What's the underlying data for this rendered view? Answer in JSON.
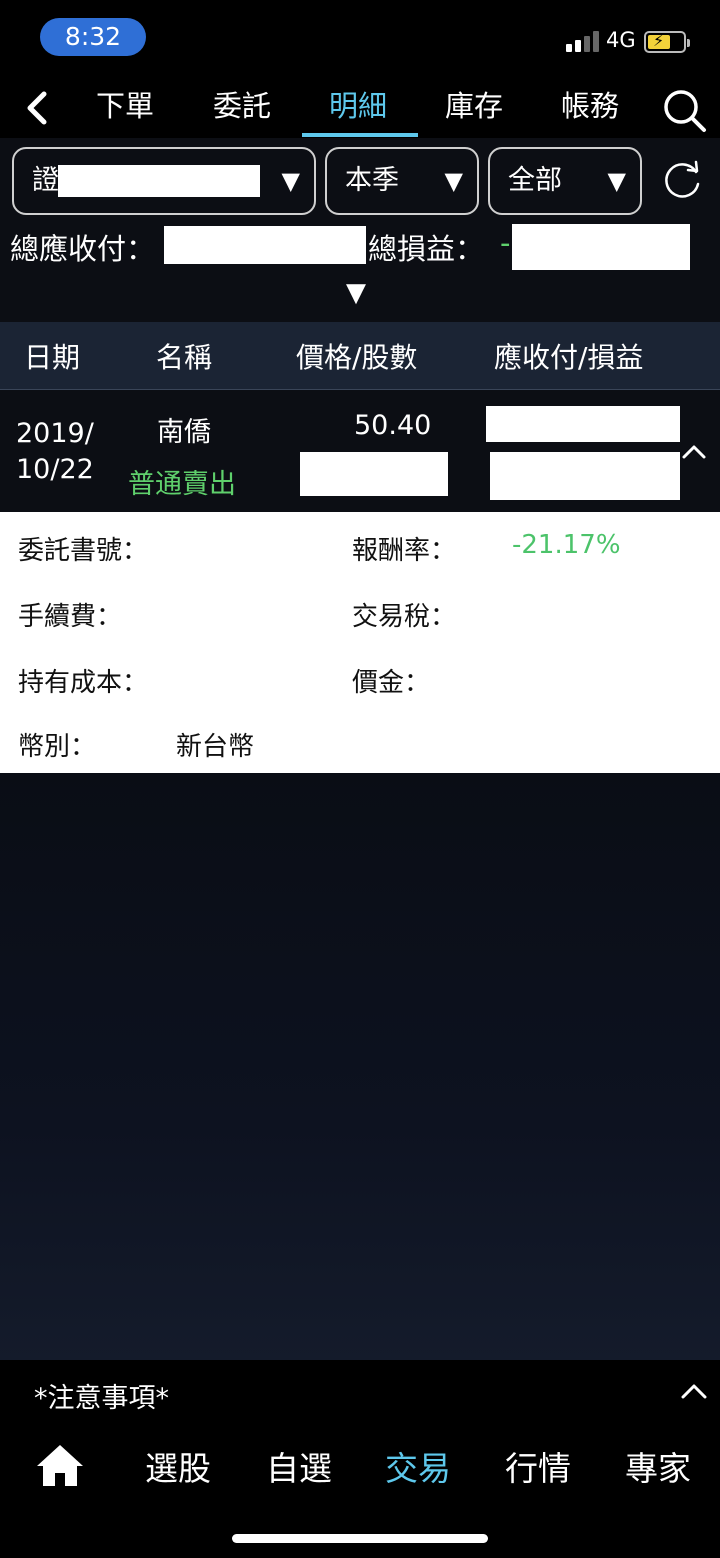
{
  "status_bar": {
    "time": "8:32",
    "network": "4G",
    "battery_charging": true,
    "time_pill_color": "#2f6fd6"
  },
  "nav": {
    "tabs": [
      {
        "label": "下單",
        "active": false
      },
      {
        "label": "委託",
        "active": false
      },
      {
        "label": "明細",
        "active": true
      },
      {
        "label": "庫存",
        "active": false
      },
      {
        "label": "帳務",
        "active": false
      }
    ],
    "accent_color": "#5ec8ec",
    "back_icon": "chevron-left-icon",
    "search_icon": "search-icon"
  },
  "filters": {
    "account_prefix": "證",
    "period": "本季",
    "scope": "全部",
    "refresh_icon": "refresh-icon"
  },
  "summary": {
    "receivable_label": "總應收付：",
    "pnl_label": "總損益：",
    "pnl_sign": "-"
  },
  "table": {
    "headers": [
      "日期",
      "名稱",
      "價格/股數",
      "應收付/損益"
    ],
    "rows": [
      {
        "date_line1": "2019/",
        "date_line2": "10/22",
        "name": "南僑",
        "trade_type": "普通賣出",
        "price": "50.40"
      }
    ]
  },
  "detail": {
    "order_no_label": "委託書號：",
    "return_rate_label": "報酬率：",
    "return_rate_value": "-21.17%",
    "fee_label": "手續費：",
    "tax_label": "交易稅：",
    "cost_label": "持有成本：",
    "amount_label": "價金：",
    "currency_label": "幣別：",
    "currency_value": "新台幣",
    "loss_color": "#4cc36a"
  },
  "notice": {
    "text": "*注意事項*"
  },
  "tabbar": {
    "home_icon": "home-icon",
    "items": [
      {
        "label": "選股",
        "active": false
      },
      {
        "label": "自選",
        "active": false
      },
      {
        "label": "交易",
        "active": true
      },
      {
        "label": "行情",
        "active": false
      },
      {
        "label": "專家",
        "active": false
      }
    ]
  }
}
